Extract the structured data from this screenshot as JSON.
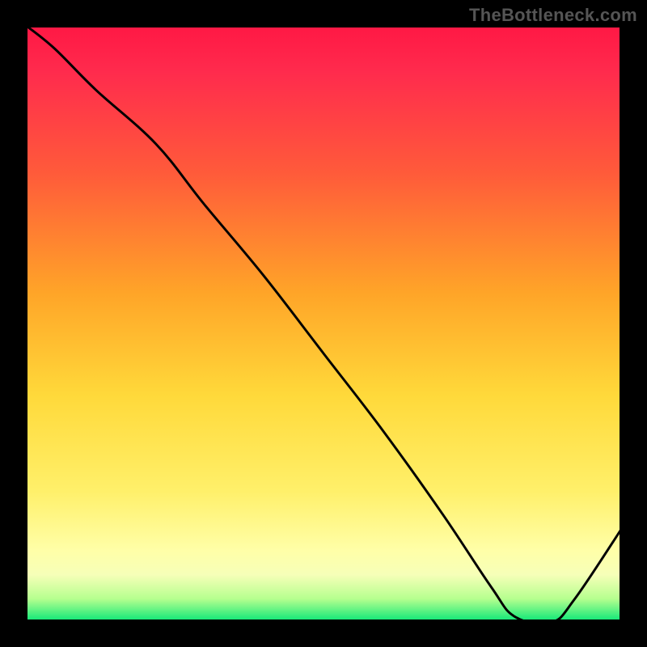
{
  "attribution": "TheBottleneck.com",
  "bottom_label": "",
  "chart_data": {
    "type": "line",
    "title": "",
    "xlabel": "",
    "ylabel": "",
    "xlim": [
      0,
      100
    ],
    "ylim": [
      0,
      100
    ],
    "grid": false,
    "legend": false,
    "annotations": [],
    "series": [
      {
        "name": "curve",
        "x": [
          0,
          5,
          12,
          22,
          30,
          40,
          50,
          60,
          70,
          78,
          82,
          88,
          92,
          100
        ],
        "values": [
          100,
          96,
          89,
          80,
          70,
          58,
          45,
          32,
          18,
          6,
          1,
          0,
          4,
          16
        ]
      }
    ],
    "notes": "Single black curve over a vertical heat gradient. Curve starts at top-left, slopes down with a slight knee near x≈22, reaches a minimum near x≈86–88, then rises toward bottom-right. Values are read off relative to the square plot area; no numeric axes are printed in the image."
  },
  "colors": {
    "curve": "#000000",
    "gradient_top": "#ff1744",
    "gradient_mid": "#ffd93a",
    "gradient_bottom": "#00e676",
    "bottom_label": "#c8452d",
    "attribution": "#555555"
  }
}
